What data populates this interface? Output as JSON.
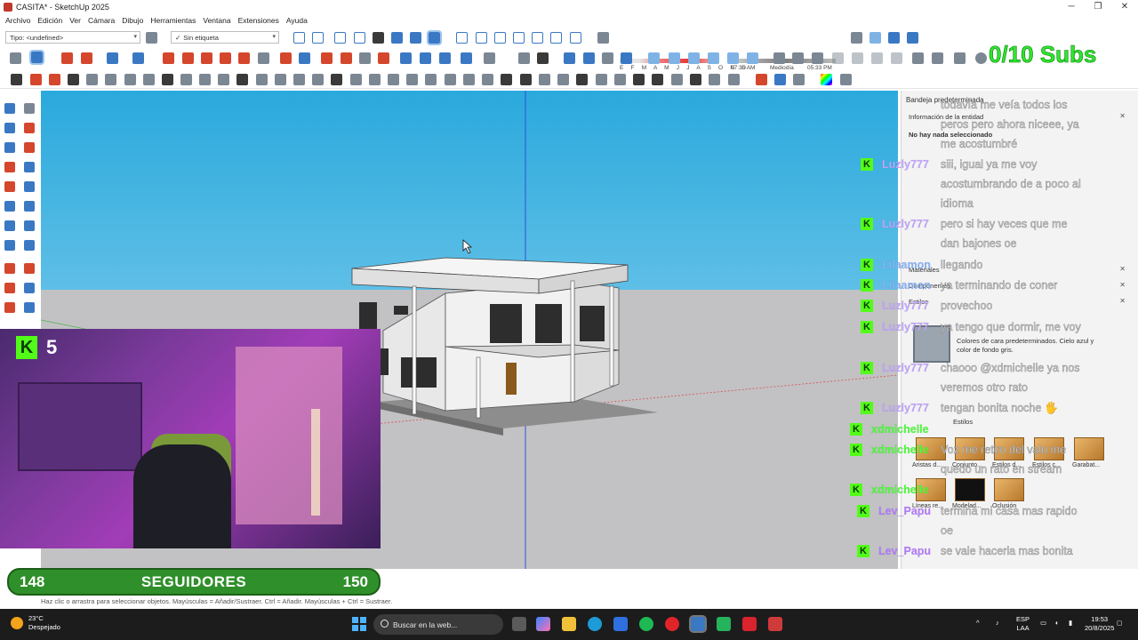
{
  "window": {
    "title": "CASITA* - SketchUp 2025",
    "controls": [
      "─",
      "❐",
      "✕"
    ]
  },
  "menu": [
    "Archivo",
    "Edición",
    "Ver",
    "Cámara",
    "Dibujo",
    "Herramientas",
    "Ventana",
    "Extensiones",
    "Ayuda"
  ],
  "toolbar": {
    "type_dropdown": "Tipo: <undefined>",
    "tag_dropdown": "Sin etiqueta",
    "months": "E F M A M J J A S O N D",
    "time_start": "07:35 AM",
    "time_mid": "Mediodía",
    "time_end": "05:33 PM"
  },
  "stream": {
    "subs_label": "0/10 Subs",
    "viewer_count": "5",
    "followers_current": "148",
    "followers_title": "SEGUIDORES",
    "followers_goal": "150"
  },
  "status": {
    "hint": "Haz clic o arrastra para seleccionar objetos. Mayúsculas = Añadir/Sustraer. Ctrl = Añadir. Mayúsculas + Ctrl = Sustraer."
  },
  "tray": {
    "title": "Bandeja predeterminada",
    "entity_info_heading": "Información de la entidad",
    "nothing_selected": "No hay nada seleccionado",
    "materials_heading": "Materiales",
    "components_heading": "Componentes",
    "styles_heading": "Estilos",
    "style_description": "Colores de cara predeterminados. Cielo azul y color de fondo gris.",
    "styles_dropdown": "Estilos",
    "style_items": [
      "Aristas d...",
      "Conjunto...",
      "Estilos d...",
      "Estilos c...",
      "Garabat...",
      "Líneas re...",
      "Modelad...",
      "Oclusión"
    ]
  },
  "chat": [
    {
      "user": "",
      "color": "#c9a3ff",
      "lines": [
        "todavía me veía todos los",
        "peros pero ahora niceee, ya",
        "me acostumbré"
      ]
    },
    {
      "user": "Luzly777",
      "color": "#c3a6ff",
      "lines": [
        "siii, igual ya me voy",
        "acostumbrando de a poco al",
        "idioma"
      ]
    },
    {
      "user": "Luzly777",
      "color": "#c3a6ff",
      "lines": [
        "pero si hay veces que me",
        "dan bajones oe"
      ]
    },
    {
      "user": "Lilaamon",
      "color": "#8ab4f8",
      "lines": [
        "llegando"
      ]
    },
    {
      "user": "Lilaamon",
      "color": "#8ab4f8",
      "lines": [
        "ya terminando de coner"
      ]
    },
    {
      "user": "Luzly777",
      "color": "#c3a6ff",
      "lines": [
        "provechoo"
      ]
    },
    {
      "user": "Luzly777",
      "color": "#c3a6ff",
      "lines": [
        "ya tengo que dormir, me voy"
      ]
    },
    {
      "user": "Luzly777",
      "color": "#c3a6ff",
      "lines": [
        "chaooo @xdmichelle ya nos",
        "veremos otro rato"
      ]
    },
    {
      "user": "Luzly777",
      "color": "#c3a6ff",
      "lines": [
        "tengan bonita noche 🖐"
      ]
    },
    {
      "user": "xdmichelle",
      "color": "#4cff3a",
      "lines": [
        ""
      ]
    },
    {
      "user": "xdmichelle",
      "color": "#4cff3a",
      "lines": [
        "Voz me retiro del valo me",
        "quedo un rato en stream"
      ]
    },
    {
      "user": "xdmichelle",
      "color": "#4cff3a",
      "lines": [
        ""
      ]
    },
    {
      "user": "Lev_Papu",
      "color": "#b57bff",
      "lines": [
        "termina mi casa mas rapido",
        "oe"
      ]
    },
    {
      "user": "Lev_Papu",
      "color": "#b57bff",
      "lines": [
        "se vale hacerla mas bonita"
      ]
    }
  ],
  "taskbar": {
    "temperature": "23°C",
    "weather": "Despejado",
    "search_placeholder": "Buscar en la web...",
    "lang_top": "ESP",
    "lang_bottom": "LAA",
    "time": "19:53",
    "date": "20/8/2025"
  },
  "colors": {
    "kick_green": "#53fc18",
    "subs_green": "#2ee62e",
    "followers_bg": "#2f8f2a",
    "sky_top": "#2aa9dc",
    "ground": "#c2c2c4"
  }
}
